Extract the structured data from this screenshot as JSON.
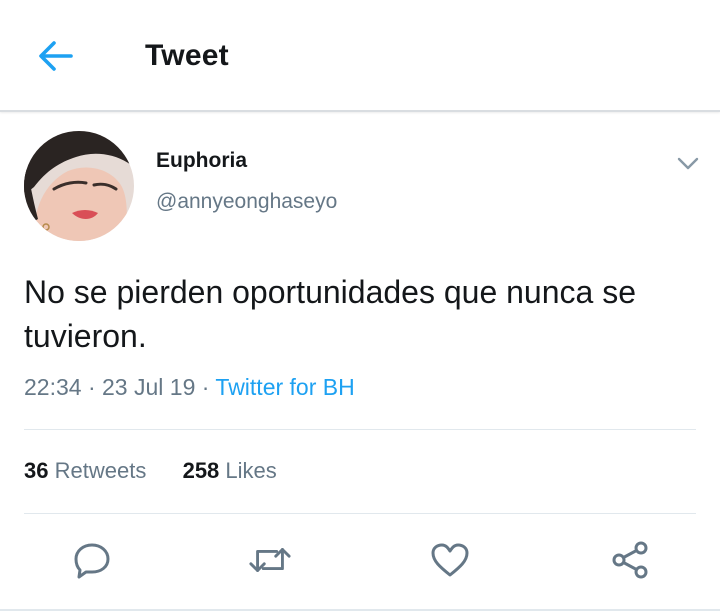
{
  "header": {
    "title": "Tweet",
    "back_icon": "arrow-left-icon",
    "accent_color": "#1da1f2"
  },
  "tweet": {
    "display_name": "Euphoria",
    "handle": "@annyeonghaseyo",
    "text": "No se pierden oportunidades que nunca se tuvieron.",
    "time": "22:34",
    "separator": "·",
    "date": "23 Jul 19",
    "source": "Twitter for BH",
    "retweets_count": "36",
    "retweets_label": "Retweets",
    "likes_count": "258",
    "likes_label": "Likes"
  },
  "actions": [
    {
      "name": "reply",
      "icon": "reply-icon"
    },
    {
      "name": "retweet",
      "icon": "retweet-icon"
    },
    {
      "name": "like",
      "icon": "heart-icon"
    },
    {
      "name": "share",
      "icon": "share-icon"
    }
  ],
  "colors": {
    "text_primary": "#14171a",
    "text_secondary": "#657786",
    "link": "#1da1f2",
    "divider": "#e1e8ed"
  }
}
